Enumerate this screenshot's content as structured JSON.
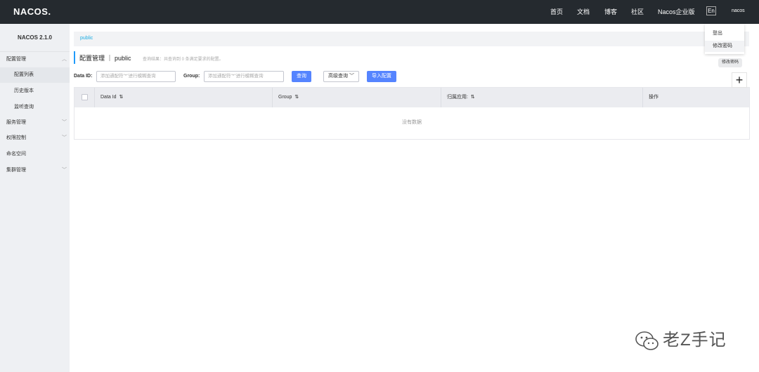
{
  "header": {
    "logo_text": "NACOS.",
    "nav": [
      "首页",
      "文档",
      "博客",
      "社区",
      "Nacos企业版"
    ],
    "lang": "En",
    "user": "nacos"
  },
  "sidebar": {
    "version": "NACOS 2.1.0",
    "items": [
      {
        "label": "配置管理"
      },
      {
        "label": "配置列表"
      },
      {
        "label": "历史版本"
      },
      {
        "label": "监听查询"
      },
      {
        "label": "服务管理"
      },
      {
        "label": "权限控制"
      },
      {
        "label": "命名空间"
      },
      {
        "label": "集群管理"
      }
    ]
  },
  "main": {
    "namespace": "public",
    "title": "配置管理 ｜ public",
    "result_hint": "查询结果：共查询到 0 条满足要求的配置。",
    "filters": {
      "data_id_label": "Data ID:",
      "data_id_placeholder": "添加通配符\"*\"进行模糊查询",
      "group_label": "Group:",
      "group_placeholder": "添加通配符\"*\"进行模糊查询",
      "query_button": "查询",
      "advanced_query": "高级查询",
      "import_button": "导入配置"
    },
    "table": {
      "columns": [
        "Data Id",
        "Group",
        "归属应用:",
        "操作"
      ],
      "empty_text": "没有数据"
    }
  },
  "user_menu": {
    "items": [
      "登出",
      "修改密码"
    ],
    "tooltip": "修改密码"
  },
  "watermark": "老Z手记",
  "colors": {
    "topbar": "#252a2f",
    "primary": "#5584ff",
    "accent": "#209bfa",
    "namespace_link": "#1eaee3"
  }
}
